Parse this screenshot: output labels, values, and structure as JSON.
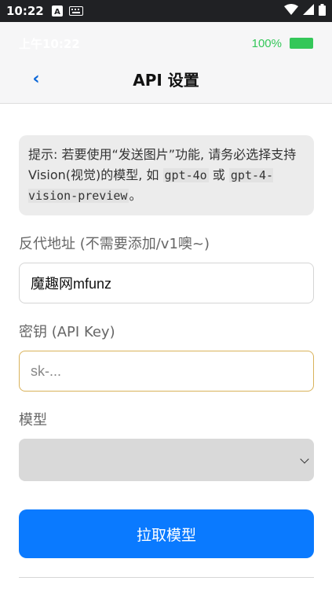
{
  "status_bar": {
    "time": "10:22",
    "icons": [
      "notification-a-icon",
      "keyboard-icon",
      "wifi-icon",
      "signal-icon",
      "battery-icon"
    ]
  },
  "inner_status": {
    "time": "上午10:22",
    "battery_percent": "100%"
  },
  "header": {
    "back_label": "‹",
    "title": "API 设置"
  },
  "hint": {
    "text_1": "提示: 若要使用“发送图片”功能, 请务必选择支持Vision(视觉)的模型, 如",
    "code_1": "gpt-4o",
    "text_2": "或",
    "code_2": "gpt-4-vision-preview",
    "text_3": "。"
  },
  "fields": {
    "proxy_label": "反代地址 (不需要添加/v1噢~)",
    "proxy_value": "魔趣网mfunz",
    "key_label": "密钥 (API Key)",
    "key_placeholder": "sk-...",
    "model_label": "模型",
    "model_value": ""
  },
  "actions": {
    "fetch_models": "拉取模型"
  },
  "colors": {
    "accent": "#0a7aff",
    "battery": "#34c759",
    "focus_border": "#d9b25a"
  }
}
